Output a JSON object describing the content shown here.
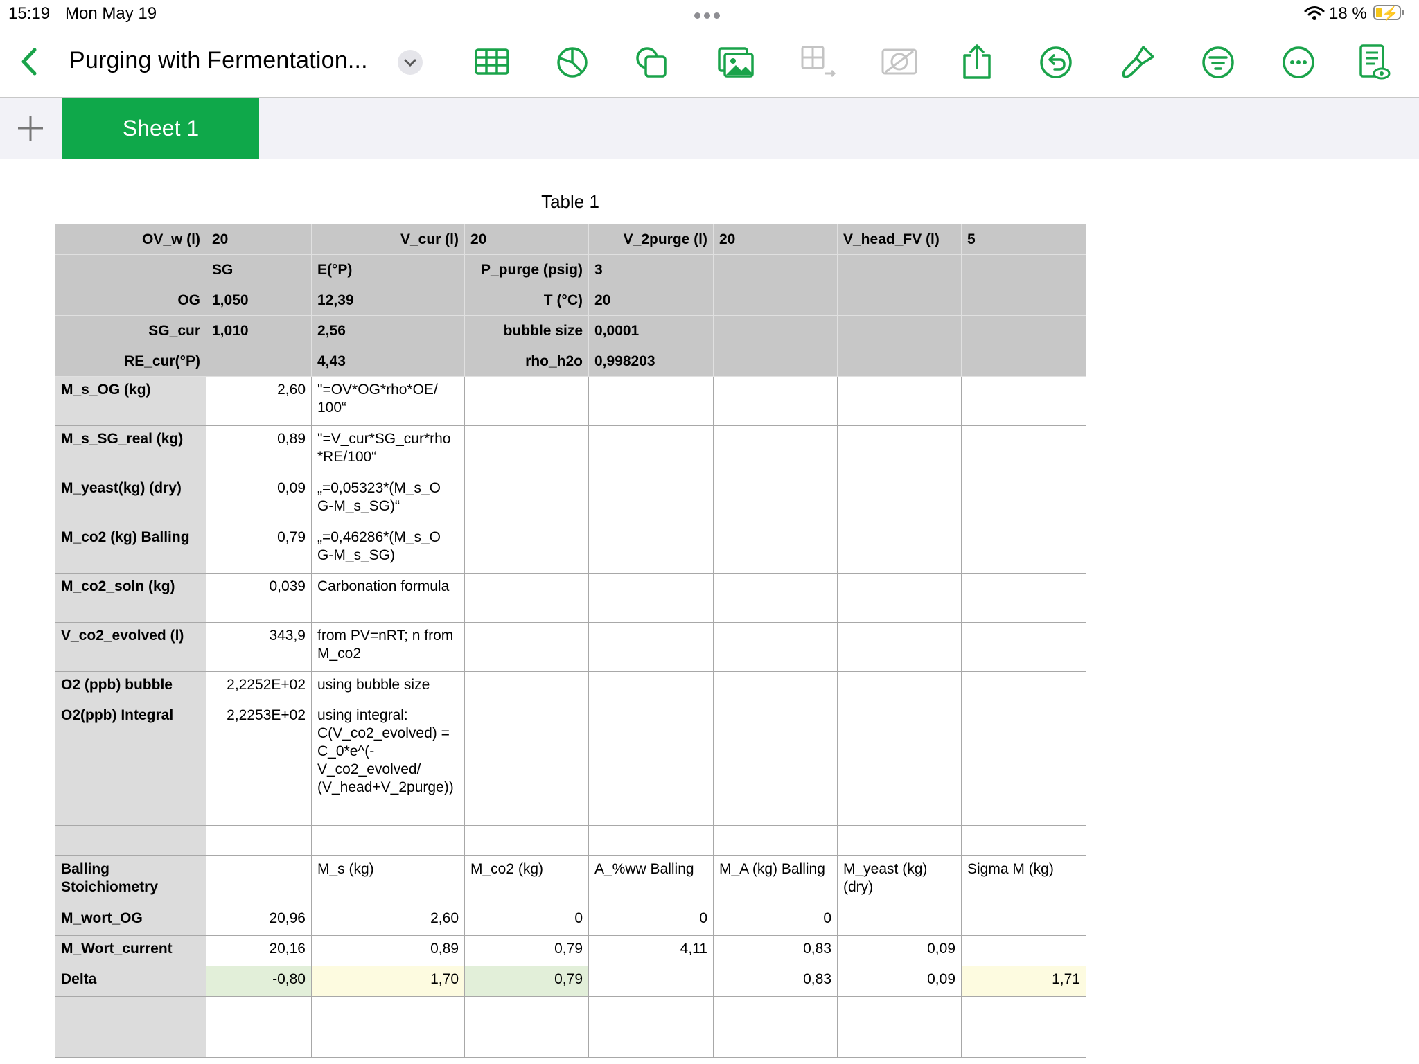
{
  "status": {
    "time": "15:19",
    "date": "Mon May 19",
    "battery": "18 %"
  },
  "toolbar": {
    "title": "Purging with Fermentation...",
    "icons": [
      "table-icon",
      "chart-icon",
      "shape-icon",
      "media-icon",
      "table-move-icon",
      "image-mask-icon",
      "share-icon",
      "undo-icon",
      "format-brush-icon",
      "organize-icon",
      "more-icon",
      "reading-view-icon"
    ]
  },
  "tabs": {
    "sheet1": "Sheet 1"
  },
  "table": {
    "title": "Table 1",
    "header_rows": [
      [
        "OV_w (l)",
        "20",
        "V_cur (l)",
        "20",
        "V_2purge (l)",
        "20",
        "V_head_FV (l)",
        "5"
      ],
      [
        "",
        "SG",
        "E(°P)",
        "P_purge (psig)",
        "3",
        "",
        "",
        ""
      ],
      [
        "OG",
        "1,050",
        "12,39",
        "T (°C)",
        "20",
        "",
        "",
        ""
      ],
      [
        "SG_cur",
        "1,010",
        "2,56",
        "bubble size",
        "0,0001",
        "",
        "",
        ""
      ],
      [
        "RE_cur(°P)",
        "",
        "4,43",
        "rho_h2o",
        "0,998203",
        "",
        "",
        ""
      ]
    ],
    "body_rows": [
      [
        "M_s_OG (kg)",
        "2,60",
        "\"=OV*OG*rho*OE/ 100“",
        "",
        "",
        "",
        "",
        ""
      ],
      [
        "M_s_SG_real (kg)",
        "0,89",
        "\"=V_cur*SG_cur*rho *RE/100“",
        "",
        "",
        "",
        "",
        ""
      ],
      [
        "M_yeast(kg) (dry)",
        "0,09",
        "„=0,05323*(M_s_O G-M_s_SG)“",
        "",
        "",
        "",
        "",
        ""
      ],
      [
        "M_co2 (kg) Balling",
        "0,79",
        "„=0,46286*(M_s_O G-M_s_SG)",
        "",
        "",
        "",
        "",
        ""
      ],
      [
        "M_co2_soln (kg)",
        "0,039",
        "Carbonation formula",
        "",
        "",
        "",
        "",
        ""
      ],
      [
        "V_co2_evolved (l)",
        "343,9",
        "from PV=nRT; n from M_co2",
        "",
        "",
        "",
        "",
        ""
      ],
      [
        "O2 (ppb) bubble",
        "2,2252E+02",
        "using bubble size",
        "",
        "",
        "",
        "",
        ""
      ],
      [
        "O2(ppb) Integral",
        "2,2253E+02",
        "using integral: C(V_co2_evolved) = C_0*e^(- V_co2_evolved/ (V_head+V_2purge))",
        "",
        "",
        "",
        "",
        ""
      ],
      [
        "",
        "",
        "",
        "",
        "",
        "",
        "",
        ""
      ],
      [
        "Balling Stoichiometry",
        "",
        "M_s (kg)",
        "M_co2 (kg)",
        "A_%ww Balling",
        "M_A (kg) Balling",
        "M_yeast (kg) (dry)",
        "Sigma M (kg)"
      ],
      [
        "M_wort_OG",
        "20,96",
        "2,60",
        "0",
        "0",
        "0",
        "",
        ""
      ],
      [
        "M_Wort_current",
        "20,16",
        "0,89",
        "0,79",
        "4,11",
        "0,83",
        "0,09",
        ""
      ],
      [
        "Delta",
        "-0,80",
        "1,70",
        "0,79",
        "",
        "0,83",
        "0,09",
        "1,71"
      ],
      [
        "",
        "",
        "",
        "",
        "",
        "",
        "",
        ""
      ],
      [
        "",
        "",
        "",
        "",
        "",
        "",
        "",
        ""
      ]
    ]
  }
}
